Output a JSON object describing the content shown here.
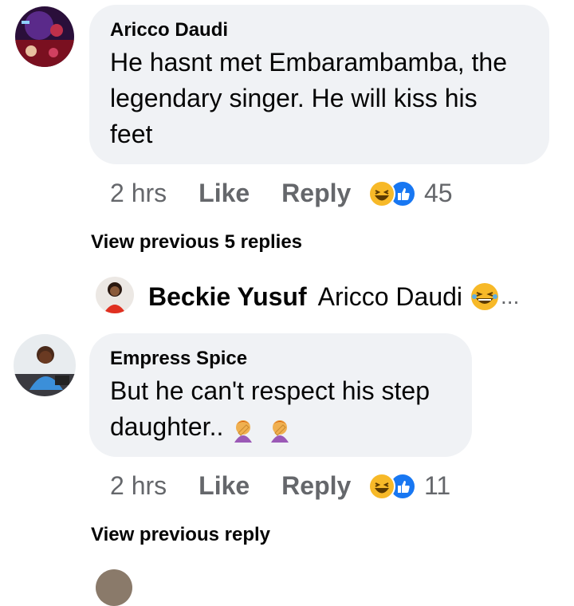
{
  "comments": [
    {
      "author": "Aricco Daudi",
      "text": "He hasnt met Embarambamba, the\nlegendary singer. He will kiss his\nfeet",
      "time": "2 hrs",
      "like": "Like",
      "reply": "Reply",
      "reaction_count": "45",
      "reactions": [
        "haha-icon",
        "like-icon"
      ]
    },
    {
      "author": "Empress Spice",
      "text": "But he can't respect his step\ndaughter..",
      "emojis": [
        "facepalm-emoji",
        "facepalm-emoji"
      ],
      "time": "2 hrs",
      "like": "Like",
      "reply": "Reply",
      "reaction_count": "11",
      "reactions": [
        "haha-icon",
        "like-icon"
      ]
    }
  ],
  "view_previous_replies": "View previous 5 replies",
  "reply_preview": {
    "author": "Beckie Yusuf",
    "text": "Aricco Daudi",
    "ellipsis": "..."
  },
  "view_previous_reply": "View previous reply",
  "colors": {
    "bubble": "#f0f2f5",
    "secondary_text": "#65676b",
    "haha": "#f7b928",
    "like": "#1877f2"
  }
}
